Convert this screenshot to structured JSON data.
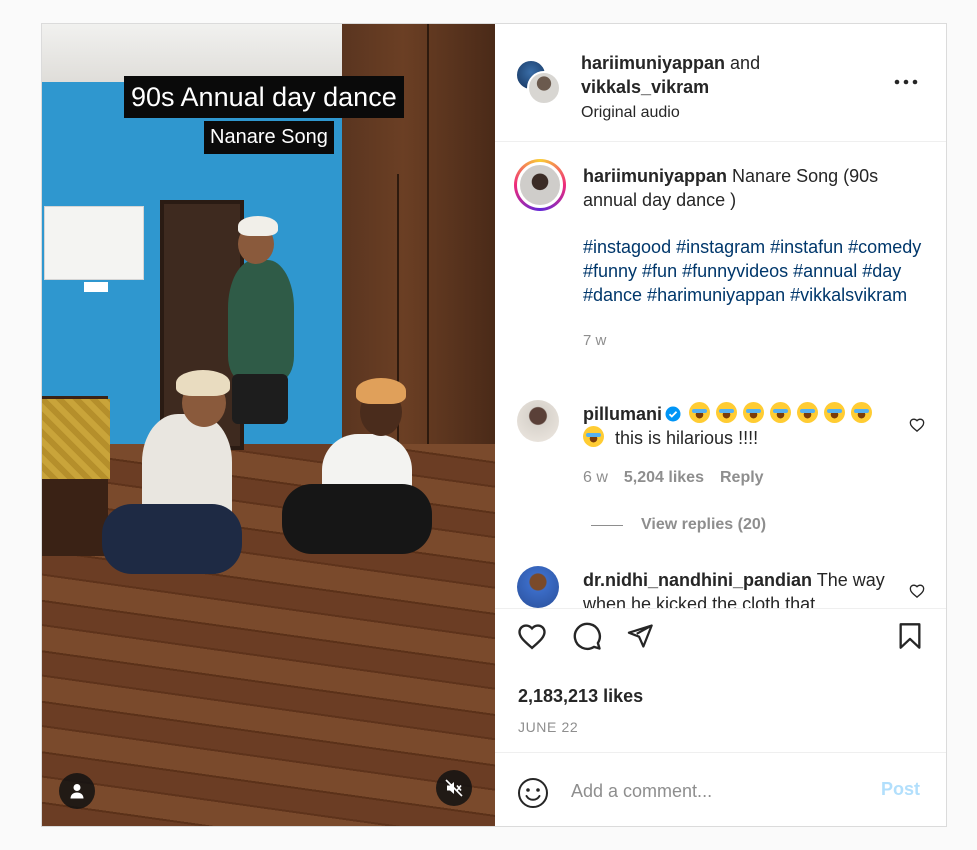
{
  "media": {
    "caption_title": "90s Annual day dance",
    "caption_subtitle": "Nanare Song",
    "user_icon": "user-icon",
    "mute_icon": "muted-speaker-icon"
  },
  "header": {
    "author": "hariimuniyappan",
    "and": "and",
    "collaborator": "vikkals_vikram",
    "audio": "Original audio",
    "more_icon": "more-horizontal-icon"
  },
  "caption": {
    "username": "hariimuniyappan",
    "text": "Nanare Song (90s annual day dance )",
    "hashtags": "#instagood #instagram #instafun #comedy #funny #fun #funnyvideos #annual #day #dance #harimuniyappan #vikkalsvikram",
    "age": "7 w"
  },
  "comments": [
    {
      "username": "pillumani",
      "verified": true,
      "text": "this is hilarious !!!!",
      "emoji_count": 8,
      "age": "6 w",
      "likes": "5,204 likes",
      "reply_label": "Reply",
      "view_replies": "View replies (20)"
    },
    {
      "username": "dr.nidhi_nandhini_pandian",
      "text": "The way when he kicked the cloth that"
    }
  ],
  "actions": {
    "like_icon": "heart-icon",
    "comment_icon": "comment-icon",
    "share_icon": "send-icon",
    "save_icon": "bookmark-icon"
  },
  "likes_count": "2,183,213 likes",
  "date": "JUNE 22",
  "add_comment": {
    "placeholder": "Add a comment...",
    "post_label": "Post",
    "emoji_icon": "smile-icon"
  },
  "colors": {
    "link": "#00376b",
    "muted": "#8e8e8e",
    "verified": "#0095f6",
    "post_disabled": "#b2dffc"
  }
}
